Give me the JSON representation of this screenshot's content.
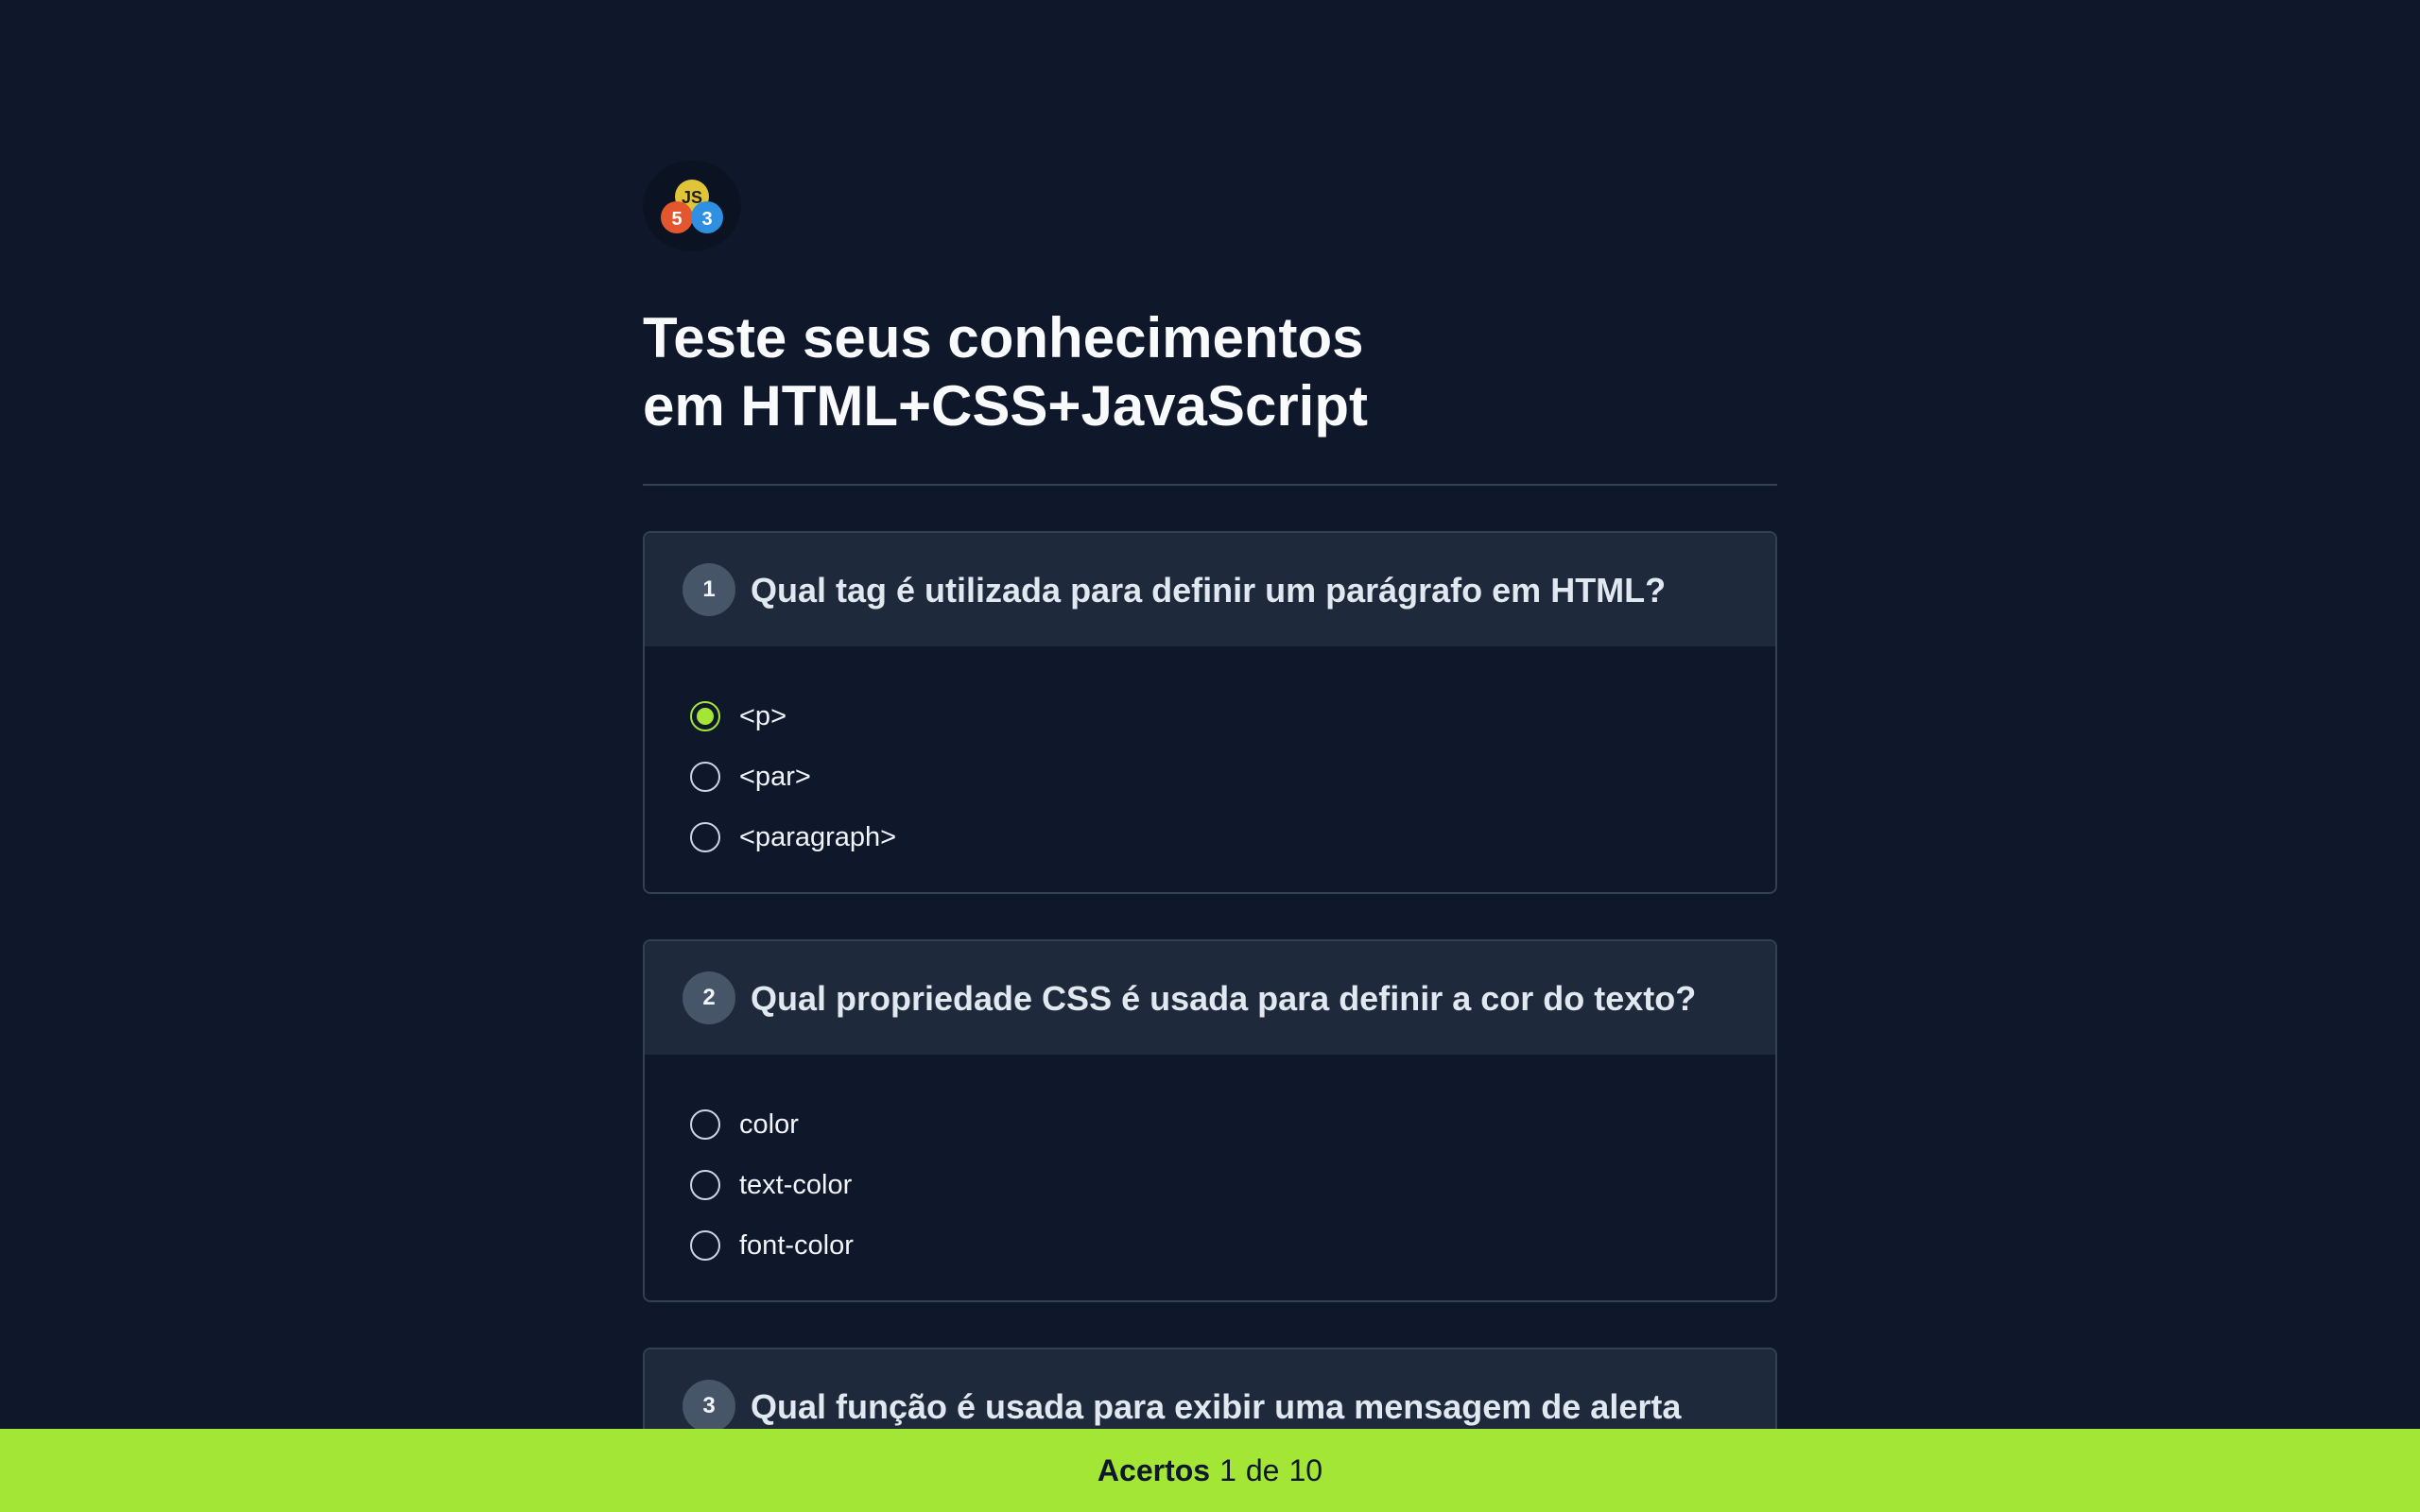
{
  "header": {
    "logo_badges": {
      "top": "JS",
      "left": "5",
      "right": "3"
    },
    "title_line1": "Teste seus conhecimentos",
    "title_line2": "em HTML+CSS+JavaScript"
  },
  "questions": [
    {
      "number": "1",
      "text": "Qual tag é utilizada para definir um parágrafo em HTML?",
      "options": [
        "<p>",
        "<par>",
        "<paragraph>"
      ],
      "selected_index": 0
    },
    {
      "number": "2",
      "text": "Qual propriedade CSS é usada para definir a cor do texto?",
      "options": [
        "color",
        "text-color",
        "font-color"
      ],
      "selected_index": null
    },
    {
      "number": "3",
      "text": "Qual função é usada para exibir uma mensagem de alerta",
      "options": [],
      "selected_index": null
    }
  ],
  "footer": {
    "label": "Acertos",
    "score": "1",
    "separator": "de",
    "total": "10"
  },
  "colors": {
    "background": "#0f172a",
    "card_header": "#1e293b",
    "accent": "#a3e635",
    "border": "#334155"
  }
}
